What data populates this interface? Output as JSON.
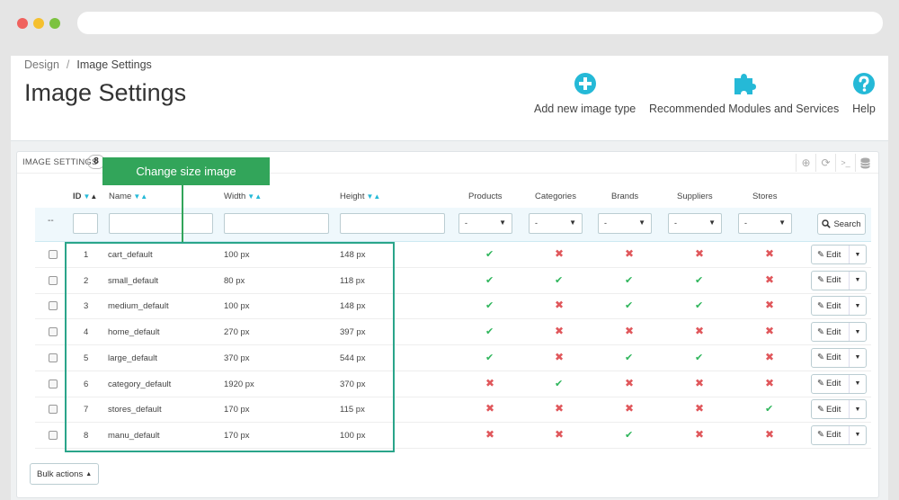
{
  "breadcrumb": {
    "parent": "Design",
    "separator": "/",
    "current": "Image Settings"
  },
  "page_title": "Image Settings",
  "toolbar": {
    "add_label": "Add new image type",
    "modules_label": "Recommended Modules and Services",
    "help_label": "Help"
  },
  "colors": {
    "accent": "#25b9d7",
    "success": "#2eb55b",
    "danger": "#e0575b",
    "annotation": "#32a55a"
  },
  "panel": {
    "title": "IMAGE SETTINGS",
    "count": "8"
  },
  "annotation": {
    "label": "Change size image"
  },
  "columns": {
    "id": "ID",
    "name": "Name",
    "width": "Width",
    "height": "Height",
    "products": "Products",
    "categories": "Categories",
    "brands": "Brands",
    "suppliers": "Suppliers",
    "stores": "Stores"
  },
  "filters": {
    "dash": "--",
    "select_value": "-",
    "search_label": "Search"
  },
  "rows": [
    {
      "id": "1",
      "name": "cart_default",
      "width": "100 px",
      "height": "148 px",
      "flags": [
        true,
        false,
        false,
        false,
        false
      ]
    },
    {
      "id": "2",
      "name": "small_default",
      "width": "80 px",
      "height": "118 px",
      "flags": [
        true,
        true,
        true,
        true,
        false
      ]
    },
    {
      "id": "3",
      "name": "medium_default",
      "width": "100 px",
      "height": "148 px",
      "flags": [
        true,
        false,
        true,
        true,
        false
      ]
    },
    {
      "id": "4",
      "name": "home_default",
      "width": "270 px",
      "height": "397 px",
      "flags": [
        true,
        false,
        false,
        false,
        false
      ]
    },
    {
      "id": "5",
      "name": "large_default",
      "width": "370 px",
      "height": "544 px",
      "flags": [
        true,
        false,
        true,
        true,
        false
      ]
    },
    {
      "id": "6",
      "name": "category_default",
      "width": "1920 px",
      "height": "370 px",
      "flags": [
        false,
        true,
        false,
        false,
        false
      ]
    },
    {
      "id": "7",
      "name": "stores_default",
      "width": "170 px",
      "height": "115 px",
      "flags": [
        false,
        false,
        false,
        false,
        true
      ]
    },
    {
      "id": "8",
      "name": "manu_default",
      "width": "170 px",
      "height": "100 px",
      "flags": [
        false,
        false,
        true,
        false,
        false
      ]
    }
  ],
  "row_action": {
    "edit_label": "Edit"
  },
  "bulk_actions_label": "Bulk actions"
}
